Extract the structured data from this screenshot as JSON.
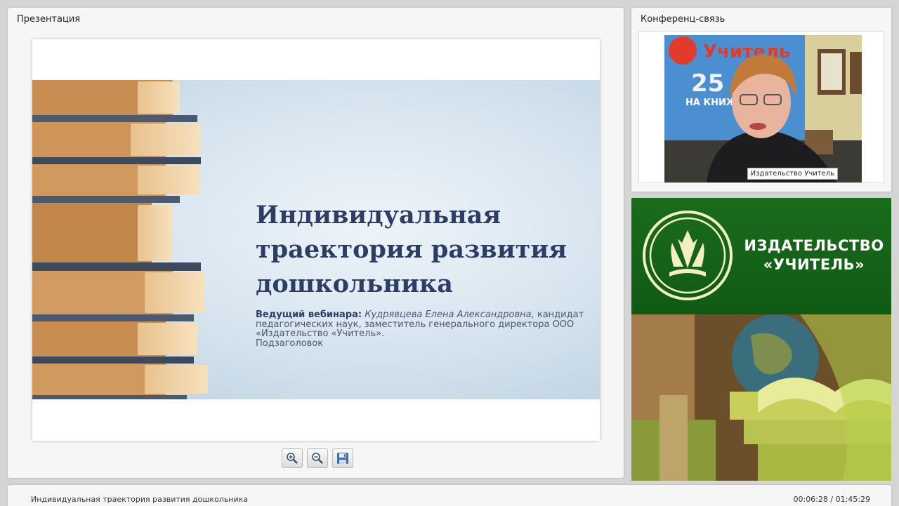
{
  "presentation": {
    "panel_title": "Презентация",
    "slide": {
      "title": "Индивидуальная траектория развития дошкольника",
      "presenter_label": "Ведущий вебинара:",
      "presenter_name": "Кудрявцева Елена Александровна,",
      "presenter_details": "кандидат педагогических наук, заместитель генерального директора ООО «Издательство «Учитель».",
      "subtitle_placeholder": "Подзаголовок"
    },
    "toolbar": {
      "zoom_in_icon": "zoom-in-icon",
      "zoom_out_icon": "zoom-out-icon",
      "save_icon": "save-icon"
    }
  },
  "conference": {
    "panel_title": "Конференц-связь",
    "video_label": "Издательство Учитель",
    "poster_text": "Учитель",
    "poster_number": "25",
    "poster_caption": "НА КНИЖ"
  },
  "ad": {
    "brand_line1": "ИЗДАТЕЛЬСТВО",
    "brand_line2": "«УЧИТЕЛЬ»"
  },
  "status": {
    "title": "Индивидуальная траектория развития дошкольника",
    "time": "00:06:28 / 01:45:29"
  },
  "colors": {
    "slide_title": "#2c3e63",
    "brand_green": "#1b6c1d",
    "background": "#d5d5d5"
  }
}
